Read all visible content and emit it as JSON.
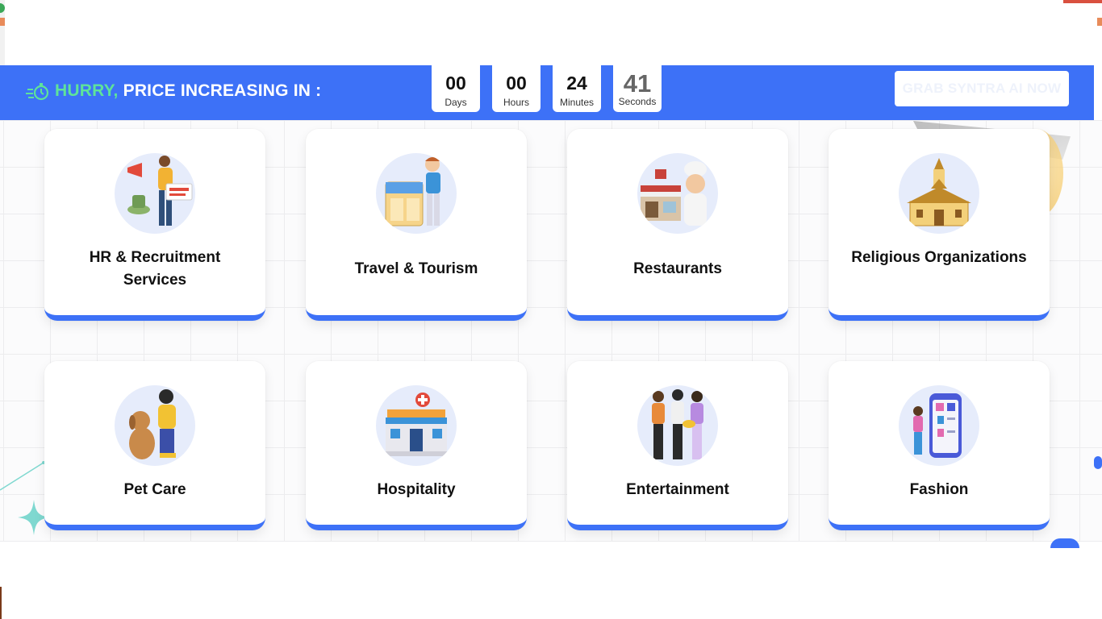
{
  "banner": {
    "hurry": "HURRY,",
    "price_text": "PRICE INCREASING IN :",
    "icon": "stopwatch-icon",
    "countdown": [
      {
        "value": "00",
        "label": "Days"
      },
      {
        "value": "00",
        "label": "Hours"
      },
      {
        "value": "24",
        "label": "Minutes"
      },
      {
        "value": "41",
        "label": "Seconds"
      }
    ],
    "cta_label": "GRAB SYNTRA AI NOW"
  },
  "colors": {
    "brand_blue": "#3d71f7",
    "accent_green": "#5ee39a",
    "avatar_bg": "#e6ecfb"
  },
  "industries": [
    {
      "title": "HR & Recruitment Services",
      "icon": "hiring-megaphone-icon"
    },
    {
      "title": "Travel & Tourism",
      "icon": "travel-itinerary-icon"
    },
    {
      "title": "Restaurants",
      "icon": "chef-restaurant-icon"
    },
    {
      "title": "Religious Organizations",
      "icon": "church-icon"
    },
    {
      "title": "Pet Care",
      "icon": "pet-dog-icon"
    },
    {
      "title": "Hospitality",
      "icon": "hospital-building-icon"
    },
    {
      "title": "Entertainment",
      "icon": "musicians-icon"
    },
    {
      "title": "Fashion",
      "icon": "fashion-shopping-app-icon"
    }
  ]
}
